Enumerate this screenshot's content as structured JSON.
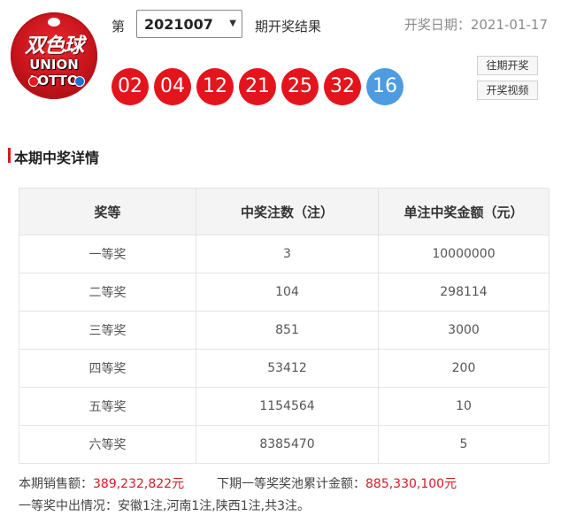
{
  "logo": {
    "cn": "双色球",
    "en_line1": "UNION",
    "en_line2": "LOTTO"
  },
  "header": {
    "prefix": "第",
    "selected_issue": "2021007",
    "suffix": "期开奖结果",
    "draw_date": "开奖日期：2021-01-17"
  },
  "balls": {
    "red": [
      "02",
      "04",
      "12",
      "21",
      "25",
      "32"
    ],
    "blue": "16",
    "red_color": "#e4141d",
    "blue_color": "#4d9be0"
  },
  "side_buttons": {
    "history": "往期开奖",
    "video": "开奖视频"
  },
  "section": {
    "title": "本期中奖详情"
  },
  "table": {
    "headers": [
      "奖等",
      "中奖注数（注）",
      "单注中奖金额（元）"
    ],
    "rows": [
      [
        "一等奖",
        "3",
        "10000000"
      ],
      [
        "二等奖",
        "104",
        "298114"
      ],
      [
        "三等奖",
        "851",
        "3000"
      ],
      [
        "四等奖",
        "53412",
        "200"
      ],
      [
        "五等奖",
        "1154564",
        "10"
      ],
      [
        "六等奖",
        "8385470",
        "5"
      ]
    ]
  },
  "footer": {
    "sales_label": "本期销售额：",
    "sales_value": "389,232,822元",
    "pool_label": "下期一等奖奖池累计金额：",
    "pool_value": "885,330,100元",
    "winners": "一等奖中出情况：安徽1注,河南1注,陕西1注,共3注。"
  }
}
